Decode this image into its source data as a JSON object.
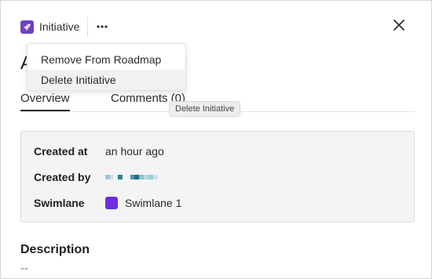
{
  "header": {
    "type_label": "Initiative",
    "type_icon": "rocket-icon",
    "accent_color": "#6f42c1"
  },
  "title": "A",
  "tabs": [
    {
      "label": "Overview",
      "active": true
    },
    {
      "label": "Comments (0)",
      "active": false
    }
  ],
  "menu": {
    "items": [
      {
        "label": "Remove From Roadmap"
      },
      {
        "label": "Delete Initiative",
        "hovered": true
      }
    ]
  },
  "tooltip": "Delete Initiative",
  "details": {
    "created_at_label": "Created at",
    "created_at_value": "an hour ago",
    "created_by_label": "Created by",
    "swimlane_label": "Swimlane",
    "swimlane_value": "Swimlane 1",
    "swimlane_color": "#6d2ee0"
  },
  "description": {
    "heading": "Description",
    "value": "--"
  }
}
